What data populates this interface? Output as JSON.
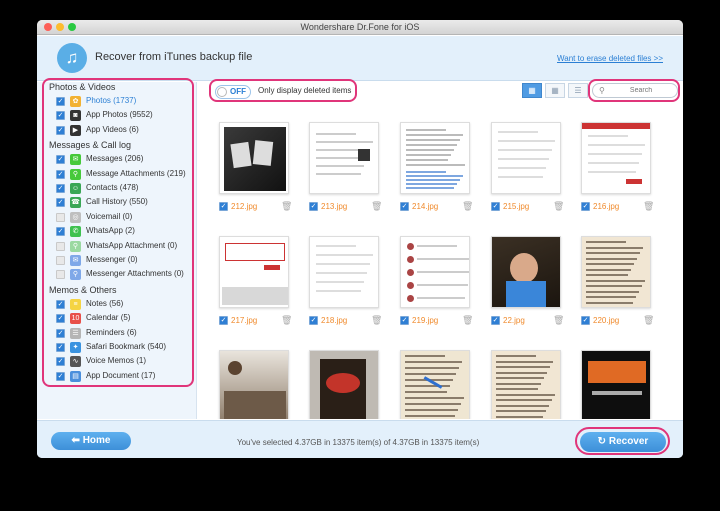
{
  "window": {
    "title": "Wondershare Dr.Fone for iOS"
  },
  "header": {
    "logo_glyph": "♫",
    "title": "Recover from iTunes backup file",
    "erase_link": "Want to erase deleted files >>"
  },
  "sidebar": {
    "categories": [
      {
        "title": "Photos & Videos",
        "items": [
          {
            "label": "Photos (1737)",
            "checked": true,
            "icon": "photos-icon",
            "icon_color": "#f2b233",
            "glyph": "✿",
            "active": true
          },
          {
            "label": "App Photos (9552)",
            "checked": true,
            "icon": "app-photos-icon",
            "icon_color": "#333333",
            "glyph": "◙"
          },
          {
            "label": "App Videos (6)",
            "checked": true,
            "icon": "app-videos-icon",
            "icon_color": "#333333",
            "glyph": "▶"
          }
        ]
      },
      {
        "title": "Messages & Call log",
        "items": [
          {
            "label": "Messages (206)",
            "checked": true,
            "icon": "messages-icon",
            "icon_color": "#46c93a",
            "glyph": "✉"
          },
          {
            "label": "Message Attachments (219)",
            "checked": true,
            "icon": "message-attachments-icon",
            "icon_color": "#46c93a",
            "glyph": "⚲"
          },
          {
            "label": "Contacts (478)",
            "checked": true,
            "icon": "contacts-icon",
            "icon_color": "#3aa655",
            "glyph": "☺"
          },
          {
            "label": "Call History (550)",
            "checked": true,
            "icon": "call-history-icon",
            "icon_color": "#3aa655",
            "glyph": "☎"
          },
          {
            "label": "Voicemail (0)",
            "checked": false,
            "icon": "voicemail-icon",
            "icon_color": "#bfbfbf",
            "glyph": "◎"
          },
          {
            "label": "WhatsApp (2)",
            "checked": true,
            "icon": "whatsapp-icon",
            "icon_color": "#3fc14f",
            "glyph": "✆"
          },
          {
            "label": "WhatsApp Attachment (0)",
            "checked": false,
            "icon": "whatsapp-attachment-icon",
            "icon_color": "#9bd9a1",
            "glyph": "⚲"
          },
          {
            "label": "Messenger (0)",
            "checked": false,
            "icon": "messenger-icon",
            "icon_color": "#7fa8e8",
            "glyph": "✉"
          },
          {
            "label": "Messenger Attachments (0)",
            "checked": false,
            "icon": "messenger-attachments-icon",
            "icon_color": "#7fa8e8",
            "glyph": "⚲"
          }
        ]
      },
      {
        "title": "Memos & Others",
        "items": [
          {
            "label": "Notes (56)",
            "checked": true,
            "icon": "notes-icon",
            "icon_color": "#f5d443",
            "glyph": "≡"
          },
          {
            "label": "Calendar (5)",
            "checked": true,
            "icon": "calendar-icon",
            "icon_color": "#e8504a",
            "glyph": "10"
          },
          {
            "label": "Reminders (6)",
            "checked": true,
            "icon": "reminders-icon",
            "icon_color": "#b5b5b5",
            "glyph": "☰"
          },
          {
            "label": "Safari Bookmark (540)",
            "checked": true,
            "icon": "safari-bookmark-icon",
            "icon_color": "#3a93e0",
            "glyph": "✦"
          },
          {
            "label": "Voice Memos (1)",
            "checked": true,
            "icon": "voice-memos-icon",
            "icon_color": "#555555",
            "glyph": "∿"
          },
          {
            "label": "App Document (17)",
            "checked": true,
            "icon": "app-document-icon",
            "icon_color": "#4a8fdc",
            "glyph": "▤"
          }
        ]
      }
    ]
  },
  "toolbar": {
    "toggle_text": "OFF",
    "toggle_label": "Only display deleted items",
    "search_placeholder": "Search",
    "view_modes": [
      "grid-large",
      "grid-small",
      "list"
    ]
  },
  "grid": {
    "items": [
      {
        "name": "212.jpg",
        "kind": "dark-photo"
      },
      {
        "name": "213.jpg",
        "kind": "email"
      },
      {
        "name": "214.jpg",
        "kind": "text"
      },
      {
        "name": "215.jpg",
        "kind": "form"
      },
      {
        "name": "216.jpg",
        "kind": "form-red"
      },
      {
        "name": "217.jpg",
        "kind": "keyboard"
      },
      {
        "name": "218.jpg",
        "kind": "form"
      },
      {
        "name": "219.jpg",
        "kind": "chat"
      },
      {
        "name": "22.jpg",
        "kind": "baby"
      },
      {
        "name": "220.jpg",
        "kind": "book"
      },
      {
        "name": "",
        "kind": "crowd"
      },
      {
        "name": "",
        "kind": "movie"
      },
      {
        "name": "",
        "kind": "book-blue"
      },
      {
        "name": "",
        "kind": "book"
      },
      {
        "name": "",
        "kind": "station"
      }
    ]
  },
  "footer": {
    "home_label": "Home",
    "status": "You've selected 4.37GB in 13375 item(s) of 4.37GB in 13375 item(s)",
    "recover_label": "Recover"
  },
  "colors": {
    "accent": "#2b7fd4",
    "highlight": "#e0357a",
    "filename": "#f08a2c"
  }
}
